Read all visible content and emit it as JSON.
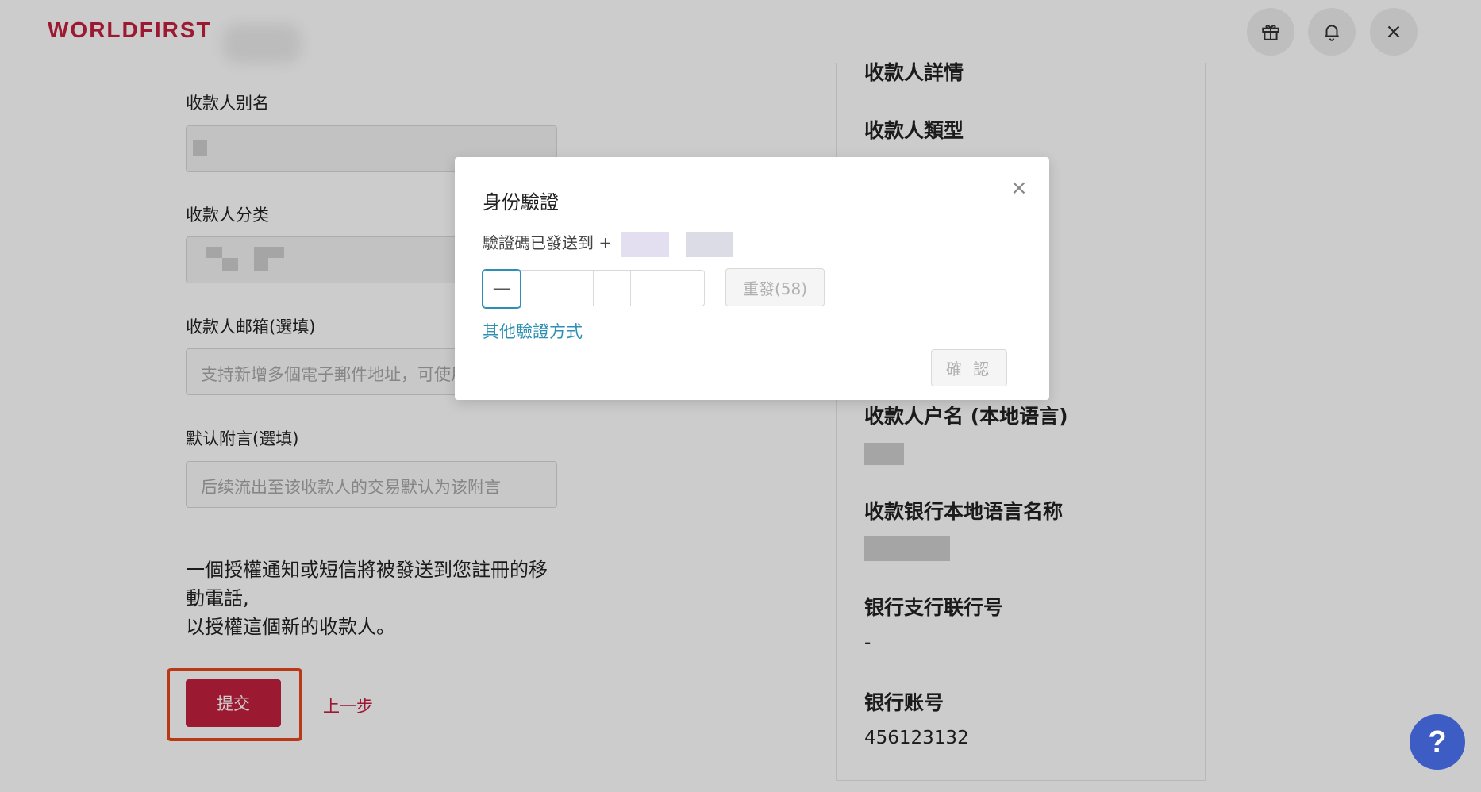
{
  "header": {
    "logo": "WORLDFIRST",
    "icons": [
      "gift-icon",
      "bell-icon",
      "close-icon"
    ]
  },
  "form": {
    "alias_label": "收款人别名",
    "category_label": "收款人分类",
    "email_label": "收款人邮箱(選填)",
    "email_placeholder": "支持新增多個電子郵件地址，可使用",
    "note_label": "默认附言(選填)",
    "note_placeholder": "后续流出至该收款人的交易默认为该附言",
    "notice_line1": "一個授權通知或短信將被發送到您註冊的移",
    "notice_line2": "動電話,",
    "notice_line3": "以授權這個新的收款人。",
    "submit_label": "提交",
    "prev_label": "上一步"
  },
  "details": {
    "section_title": "收款人詳情",
    "type_label": "收款人類型",
    "local_name_label": "收款人户名 (本地语言)",
    "bank_local_name_label": "收款银行本地语言名称",
    "branch_label": "银行支行联行号",
    "branch_value": "-",
    "account_label": "银行账号",
    "account_value": "456123132"
  },
  "modal": {
    "title": "身份驗證",
    "sent_text": "驗證碼已發送到 +",
    "code_first_char": "一",
    "resend_label": "重發(58)",
    "other_methods": "其他驗證方式",
    "confirm_label": "確 認"
  },
  "help": {
    "label": "?"
  },
  "colors": {
    "brand": "#c4203f",
    "link": "#2c8fb3",
    "help": "#3d5dc4",
    "highlight": "#e8471c"
  }
}
